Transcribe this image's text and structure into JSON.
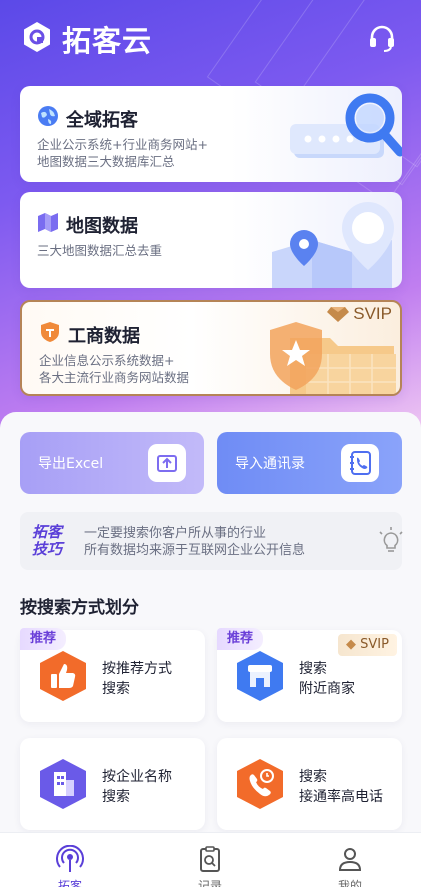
{
  "header": {
    "app_name": "拓客云",
    "support_icon": "headset-icon",
    "logo_icon": "hexagon-logo-icon"
  },
  "cards": [
    {
      "title": "全域拓客",
      "desc1": "企业公示系统+行业商务网站+",
      "desc2": "地图数据三大数据库汇总",
      "icon": "globe-icon"
    },
    {
      "title": "地图数据",
      "desc1": "三大地图数据汇总去重",
      "desc2": "",
      "icon": "map-icon"
    },
    {
      "title": "工商数据",
      "desc1": "企业信息公示系统数据+",
      "desc2": "各大主流行业商务网站数据",
      "icon": "shield-icon",
      "badge": "SVIP"
    }
  ],
  "actions": {
    "export": "导出Excel",
    "import": "导入通讯录"
  },
  "tips": {
    "brand_line1": "拓客",
    "brand_line2": "技巧",
    "line1": "一定要搜索你客户所从事的行业",
    "line2": "所有数据均来源于互联网企业公开信息"
  },
  "section_title": "按搜索方式划分",
  "search_cards": [
    {
      "line1": "按推荐方式",
      "line2": "搜索",
      "tag": "推荐",
      "icon": "thumbs-up-icon"
    },
    {
      "line1": "搜索",
      "line2": "附近商家",
      "tag": "推荐",
      "badge": "SVIP",
      "icon": "storefront-icon"
    },
    {
      "line1": "按企业名称",
      "line2": "搜索",
      "icon": "building-icon"
    },
    {
      "line1": "搜索",
      "line2": "接通率高电话",
      "icon": "phone-icon"
    }
  ],
  "tabs": [
    {
      "label": "拓客",
      "icon": "signal-tower-icon",
      "active": true
    },
    {
      "label": "记录",
      "icon": "clipboard-search-icon",
      "active": false
    },
    {
      "label": "我的",
      "icon": "user-icon",
      "active": false
    }
  ],
  "colors": {
    "primary": "#5a3fd8",
    "orange": "#f26b2a",
    "gold": "#b58457"
  }
}
